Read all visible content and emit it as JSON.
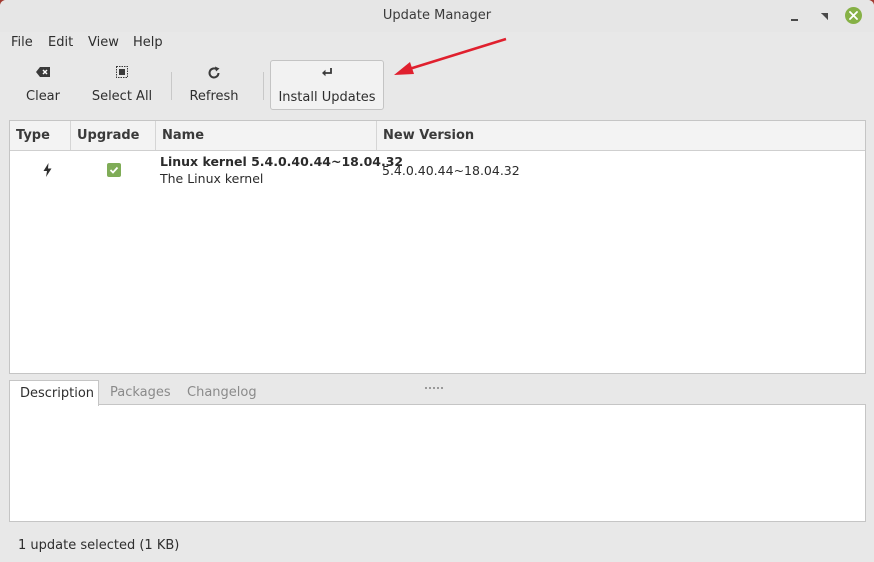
{
  "window": {
    "title": "Update Manager"
  },
  "menubar": {
    "items": [
      "File",
      "Edit",
      "View",
      "Help"
    ]
  },
  "toolbar": {
    "clear": {
      "label": "Clear",
      "icon": "backspace-icon"
    },
    "select_all": {
      "label": "Select All",
      "icon": "select-all-icon"
    },
    "refresh": {
      "label": "Refresh",
      "icon": "refresh-icon"
    },
    "install": {
      "label": "Install Updates",
      "icon": "return-arrow-icon"
    }
  },
  "table": {
    "columns": [
      "Type",
      "Upgrade",
      "Name",
      "New Version"
    ],
    "rows": [
      {
        "type_icon": "lightning-icon",
        "upgrade_checked": true,
        "name": "Linux kernel 5.4.0.40.44~18.04.32",
        "description": "The Linux kernel",
        "new_version": "5.4.0.40.44~18.04.32"
      }
    ]
  },
  "tabs": [
    "Description",
    "Packages",
    "Changelog"
  ],
  "active_tab": "Description",
  "status": {
    "text": "1 update selected (1 KB)"
  },
  "colors": {
    "close_button": "#86b146",
    "checkbox": "#7fac57",
    "annotation_arrow": "#e0202e"
  }
}
